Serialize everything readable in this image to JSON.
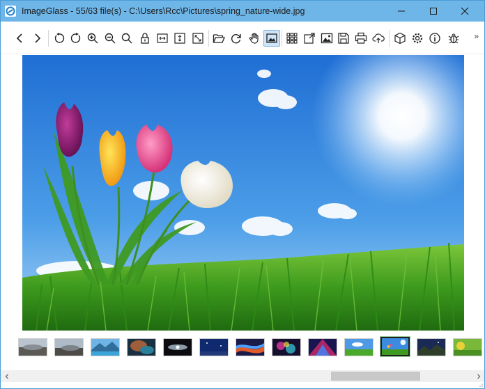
{
  "window": {
    "title": "ImageGlass - 55/63 file(s) - C:\\Users\\Rcc\\Pictures\\spring_nature-wide.jpg",
    "controls": [
      "minimize-icon",
      "maximize-icon",
      "close-icon"
    ]
  },
  "toolbar": {
    "buttons": [
      "previous-icon",
      "next-icon",
      "rotate-left-icon",
      "rotate-right-icon",
      "zoom-in-icon",
      "zoom-out-icon",
      "actual-size-icon",
      "lock-zoom-icon",
      "fit-width-icon",
      "fit-height-icon",
      "scale-to-fit-icon",
      "open-file-icon",
      "refresh-icon",
      "pan-hand-icon",
      "fullscreen-view-icon",
      "thumbnail-bar-icon",
      "checkerboard-icon",
      "slideshow-icon",
      "save-icon",
      "print-icon",
      "upload-icon",
      "extension-icon",
      "settings-icon",
      "about-icon",
      "report-bug-icon"
    ],
    "active_button": "fullscreen-view-icon",
    "overflow_label": "»"
  },
  "viewer": {
    "image_subject": "tulips-in-grass-under-sunny-sky"
  },
  "thumbnails": {
    "count_visible": 13,
    "selected_index": 10
  },
  "colors": {
    "titlebar": "#6fb6e8",
    "accent_border": "#4a9bd6",
    "active_button_bg": "#cfe5f7"
  }
}
